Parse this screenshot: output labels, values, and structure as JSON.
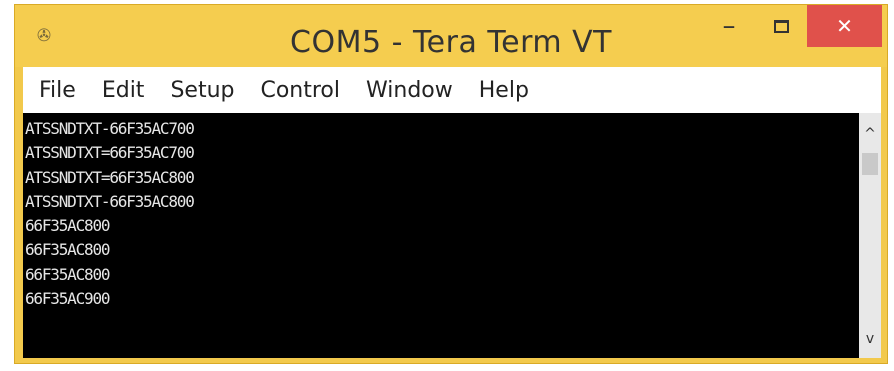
{
  "window": {
    "title": "COM5 - Tera Term VT",
    "app_icon": "tera-term-icon",
    "controls": {
      "minimize": "–",
      "close": "✕"
    },
    "accent_color": "#f5cd4f",
    "close_color": "#e0514b"
  },
  "menubar": {
    "items": [
      "File",
      "Edit",
      "Setup",
      "Control",
      "Window",
      "Help"
    ]
  },
  "terminal": {
    "background": "#000000",
    "lines": [
      "ATSSNDTXT-66F35AC700",
      "ATSSNDTXT=66F35AC700",
      "ATSSNDTXT=66F35AC800",
      "ATSSNDTXT-66F35AC800",
      "66F35AC800",
      "66F35AC800",
      "66F35AC800",
      "66F35AC900"
    ]
  },
  "scrollbar": {
    "up": "^",
    "down": "v"
  }
}
